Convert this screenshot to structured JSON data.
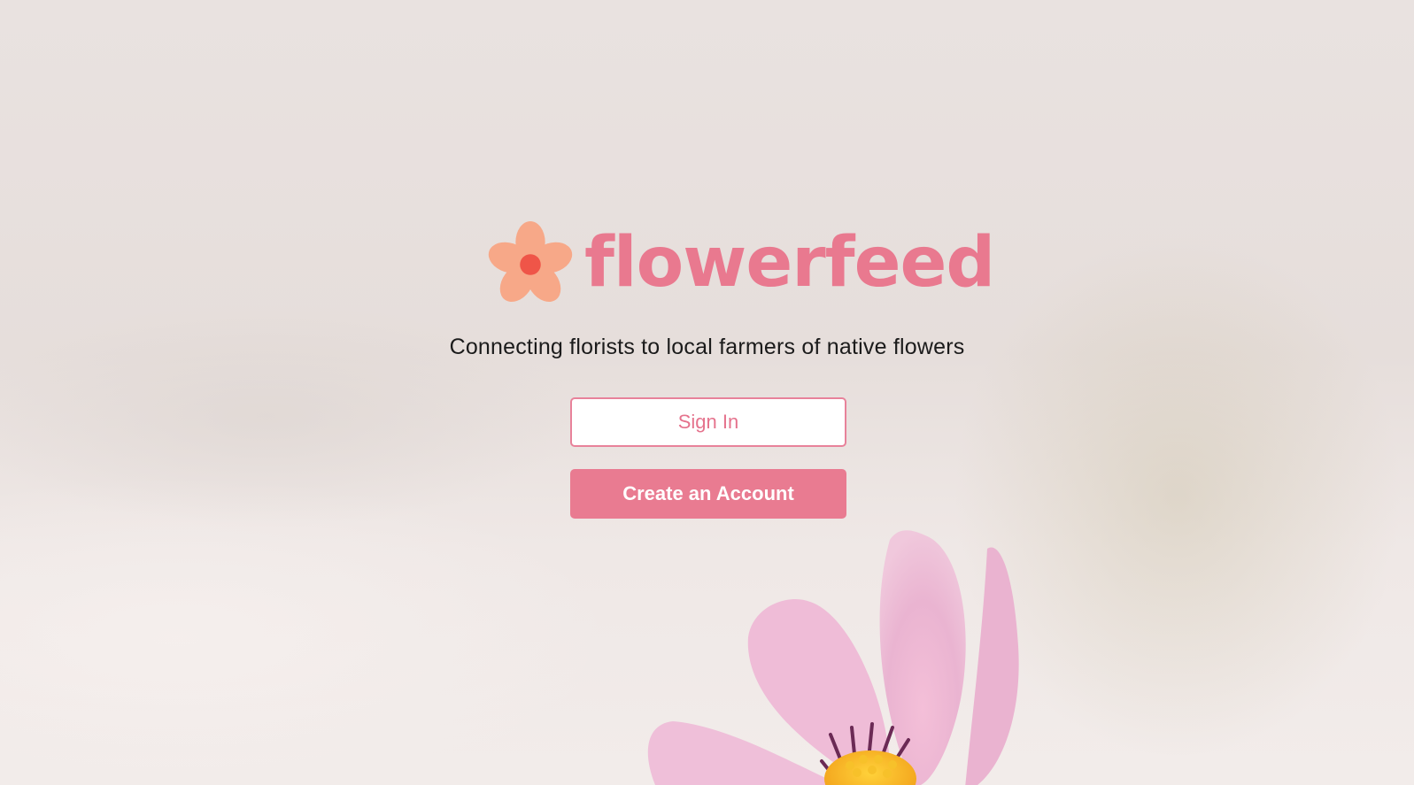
{
  "brand": {
    "name": "flowerfeed",
    "logo_icon": "flower-icon",
    "color": "#e9798f"
  },
  "tagline": "Connecting florists to local farmers of native flowers",
  "actions": {
    "sign_in_label": "Sign In",
    "create_account_label": "Create an Account"
  },
  "colors": {
    "accent": "#e97b91",
    "petal": "#f7a888",
    "center": "#ef5548",
    "text": "#1b1b1b"
  },
  "background": {
    "image": "pink-cosmos-flower-photo"
  }
}
